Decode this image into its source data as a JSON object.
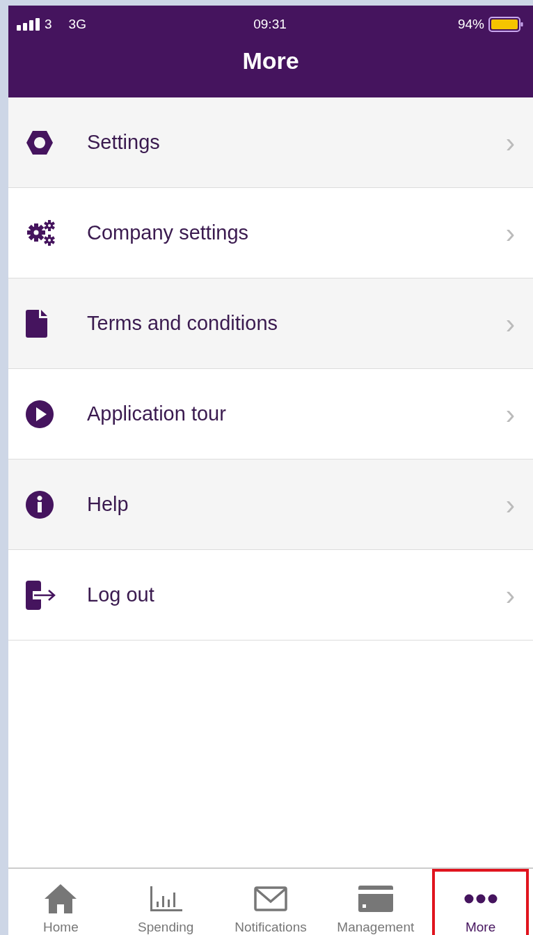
{
  "status_bar": {
    "carrier": "3",
    "network": "3G",
    "time": "09:31",
    "battery": "94%"
  },
  "header": {
    "title": "More"
  },
  "menu": [
    {
      "kind": "hexagon",
      "label": "Settings",
      "chevron": "›"
    },
    {
      "kind": "gears",
      "label": "Company settings",
      "chevron": "›"
    },
    {
      "kind": "file",
      "label": "Terms and conditions",
      "chevron": "›"
    },
    {
      "kind": "play",
      "label": "Application tour",
      "chevron": "›"
    },
    {
      "kind": "info",
      "label": "Help",
      "chevron": "›"
    },
    {
      "kind": "logout",
      "label": "Log out",
      "chevron": "›"
    }
  ],
  "tab_bar": [
    {
      "kind": "home",
      "label": "Home",
      "selected": false,
      "highlighted": false
    },
    {
      "kind": "chart",
      "label": "Spending",
      "selected": false,
      "highlighted": false
    },
    {
      "kind": "mail",
      "label": "Notifications",
      "selected": false,
      "highlighted": false
    },
    {
      "kind": "card",
      "label": "Management",
      "selected": false,
      "highlighted": false
    },
    {
      "kind": "dots",
      "label": "More",
      "selected": true,
      "highlighted": true
    }
  ]
}
